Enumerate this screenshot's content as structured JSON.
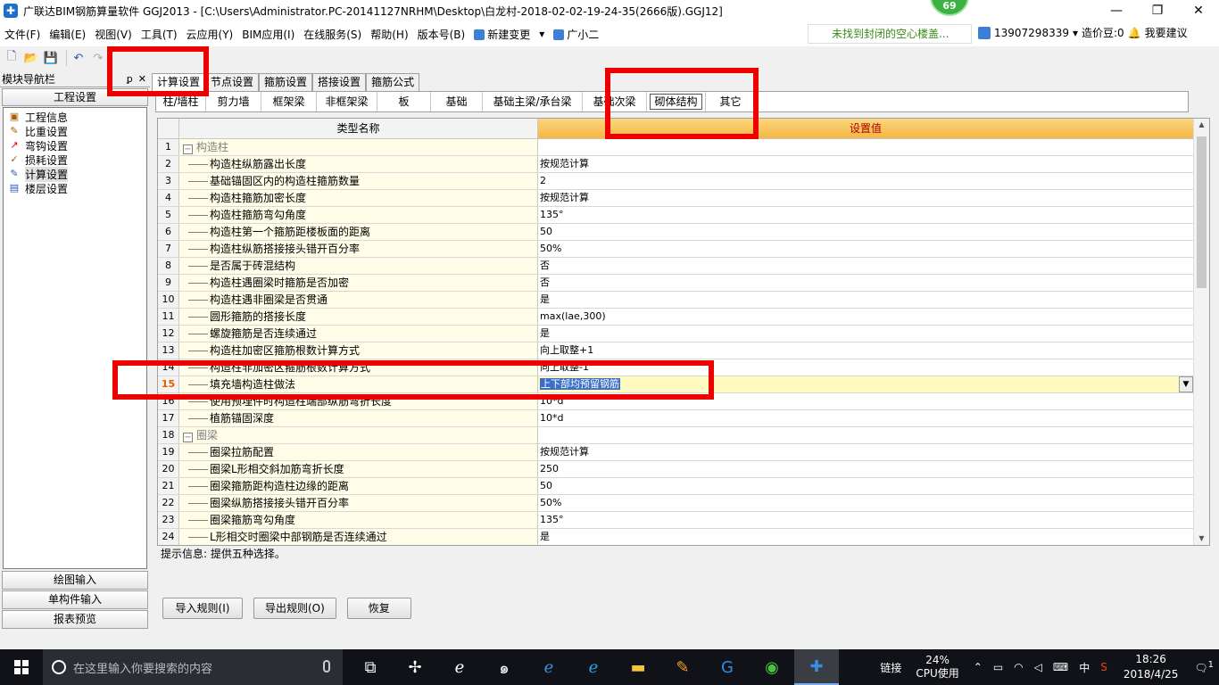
{
  "titlebar": {
    "title": "广联达BIM钢筋算量软件 GGJ2013 - [C:\\Users\\Administrator.PC-20141127NRHM\\Desktop\\白龙村-2018-02-02-19-24-35(2666版).GGJ12]",
    "badge": "69",
    "minimize": "—",
    "restore": "❐",
    "close": "✕"
  },
  "menu": {
    "items": [
      "文件(F)",
      "编辑(E)",
      "视图(V)",
      "工具(T)",
      "云应用(Y)",
      "BIM应用(I)",
      "在线服务(S)",
      "帮助(H)",
      "版本号(B)"
    ],
    "new_change": "新建变更",
    "assistant": "广小二",
    "notice": "未找到封闭的空心楼盖...",
    "phone": "13907298339",
    "price_beans": "造价豆:0",
    "suggest": "我要建议"
  },
  "toolbar": {
    "new": "🗋",
    "open": "📂",
    "save": "💾",
    "undo": "↶",
    "redo": "↷"
  },
  "leftpanel": {
    "title": "模块导航栏",
    "pin": "ꝑ",
    "close": "✕",
    "section": "工程设置",
    "items": [
      {
        "label": "工程信息",
        "icon": "info-icon"
      },
      {
        "label": "比重设置",
        "icon": "weight-icon"
      },
      {
        "label": "弯钩设置",
        "icon": "hook-icon"
      },
      {
        "label": "损耗设置",
        "icon": "loss-icon"
      },
      {
        "label": "计算设置",
        "icon": "calc-icon"
      },
      {
        "label": "楼层设置",
        "icon": "floor-icon"
      }
    ],
    "bottom": [
      "绘图输入",
      "单构件输入",
      "报表预览"
    ]
  },
  "tabs1": [
    "计算设置",
    "节点设置",
    "箍筋设置",
    "搭接设置",
    "箍筋公式"
  ],
  "tabs2": [
    "柱/墙柱",
    "剪力墙",
    "框架梁",
    "非框架梁",
    "板",
    "基础",
    "基础主梁/承台梁",
    "基础次梁",
    "砌体结构",
    "其它"
  ],
  "grid": {
    "col_name": "类型名称",
    "col_value": "设置值",
    "rows": [
      {
        "n": "1",
        "type": "cat",
        "name": "构造柱",
        "value": ""
      },
      {
        "n": "2",
        "type": "item",
        "name": "构造柱纵筋露出长度",
        "value": "按规范计算"
      },
      {
        "n": "3",
        "type": "item",
        "name": "基础锚固区内的构造柱箍筋数量",
        "value": "2"
      },
      {
        "n": "4",
        "type": "item",
        "name": "构造柱箍筋加密长度",
        "value": "按规范计算"
      },
      {
        "n": "5",
        "type": "item",
        "name": "构造柱箍筋弯勾角度",
        "value": "135°"
      },
      {
        "n": "6",
        "type": "item",
        "name": "构造柱第一个箍筋距楼板面的距离",
        "value": "50"
      },
      {
        "n": "7",
        "type": "item",
        "name": "构造柱纵筋搭接接头错开百分率",
        "value": "50%"
      },
      {
        "n": "8",
        "type": "item",
        "name": "是否属于砖混结构",
        "value": "否"
      },
      {
        "n": "9",
        "type": "item",
        "name": "构造柱遇圈梁时箍筋是否加密",
        "value": "否"
      },
      {
        "n": "10",
        "type": "item",
        "name": "构造柱遇非圈梁是否贯通",
        "value": "是"
      },
      {
        "n": "11",
        "type": "item",
        "name": "圆形箍筋的搭接长度",
        "value": "max(lae,300)"
      },
      {
        "n": "12",
        "type": "item",
        "name": "螺旋箍筋是否连续通过",
        "value": "是"
      },
      {
        "n": "13",
        "type": "item",
        "name": "构造柱加密区箍筋根数计算方式",
        "value": "向上取整+1"
      },
      {
        "n": "14",
        "type": "item",
        "name": "构造柱非加密区箍筋根数计算方式",
        "value": "向上取整-1"
      },
      {
        "n": "15",
        "type": "item",
        "name": "填充墙构造柱做法",
        "value": "上下部均预留钢筋",
        "selected": true
      },
      {
        "n": "16",
        "type": "item",
        "name": "使用预埋件时构造柱端部纵筋弯折长度",
        "value": "10*d"
      },
      {
        "n": "17",
        "type": "item",
        "name": "植筋锚固深度",
        "value": "10*d"
      },
      {
        "n": "18",
        "type": "cat",
        "name": "圈梁",
        "value": ""
      },
      {
        "n": "19",
        "type": "item",
        "name": "圈梁拉筋配置",
        "value": "按规范计算"
      },
      {
        "n": "20",
        "type": "item",
        "name": "圈梁L形相交斜加筋弯折长度",
        "value": "250"
      },
      {
        "n": "21",
        "type": "item",
        "name": "圈梁箍筋距构造柱边缘的距离",
        "value": "50"
      },
      {
        "n": "22",
        "type": "item",
        "name": "圈梁纵筋搭接接头错开百分率",
        "value": "50%"
      },
      {
        "n": "23",
        "type": "item",
        "name": "圈梁箍筋弯勾角度",
        "value": "135°"
      },
      {
        "n": "24",
        "type": "item",
        "name": "L形相交时圈梁中部钢筋是否连续通过",
        "value": "是"
      }
    ]
  },
  "hint": "提示信息: 提供五种选择。",
  "buttons": {
    "import": "导入规则(I)",
    "export": "导出规则(O)",
    "restore": "恢复"
  },
  "taskbar": {
    "search_placeholder": "在这里输入你要搜索的内容",
    "link": "链接",
    "cpu_pct": "24%",
    "cpu_label": "CPU使用",
    "ime": "中",
    "time": "18:26",
    "date": "2018/4/25",
    "notif_count": "1"
  },
  "colors": {
    "accent": "#3b6fc9",
    "header": "#f5b640",
    "annotation": "#ee0000"
  }
}
